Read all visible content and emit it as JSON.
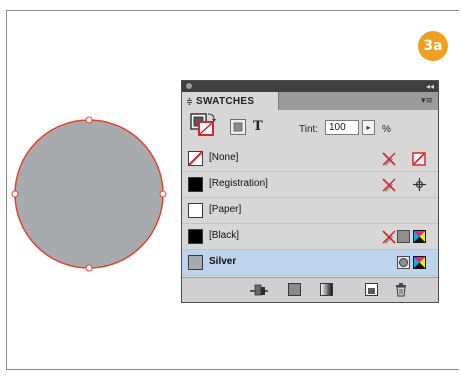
{
  "badge": {
    "label": "3a",
    "color": "#f0a021"
  },
  "canvas": {
    "circle_fill": "#a8abad",
    "selection_color": "#e8402e"
  },
  "panel": {
    "tab_arrows": "≑",
    "title": "SWATCHES",
    "menu_icon": "panel-menu-icon",
    "tint_label": "Tint:",
    "tint_value": "100",
    "tint_stepper_glyph": "▸",
    "tint_unit": "%",
    "text_glyph": "T"
  },
  "swatches": [
    {
      "name": "[None]",
      "chip": "none",
      "icons": [
        "no-edit-icon",
        "none-square-icon"
      ]
    },
    {
      "name": "[Registration]",
      "chip": "black",
      "icons": [
        "no-edit-icon",
        "registration-icon"
      ]
    },
    {
      "name": "[Paper]",
      "chip": "white",
      "icons": []
    },
    {
      "name": "[Black]",
      "chip": "black",
      "icons": [
        "no-edit-icon",
        "process-color-icon",
        "cmyk-icon"
      ]
    },
    {
      "name": "Silver",
      "chip": "silver",
      "selected": true,
      "icons": [
        "spot-color-icon",
        "cmyk-icon"
      ]
    }
  ],
  "colors": {
    "selected_row": "#bed4ec",
    "chip_silver": "#a8abad",
    "none_red": "#d9262b"
  },
  "bottom_icons": [
    "show-all-swatches-icon",
    "show-color-swatches-icon",
    "show-gradient-swatches-icon",
    "new-swatch-icon",
    "delete-swatch-icon"
  ]
}
